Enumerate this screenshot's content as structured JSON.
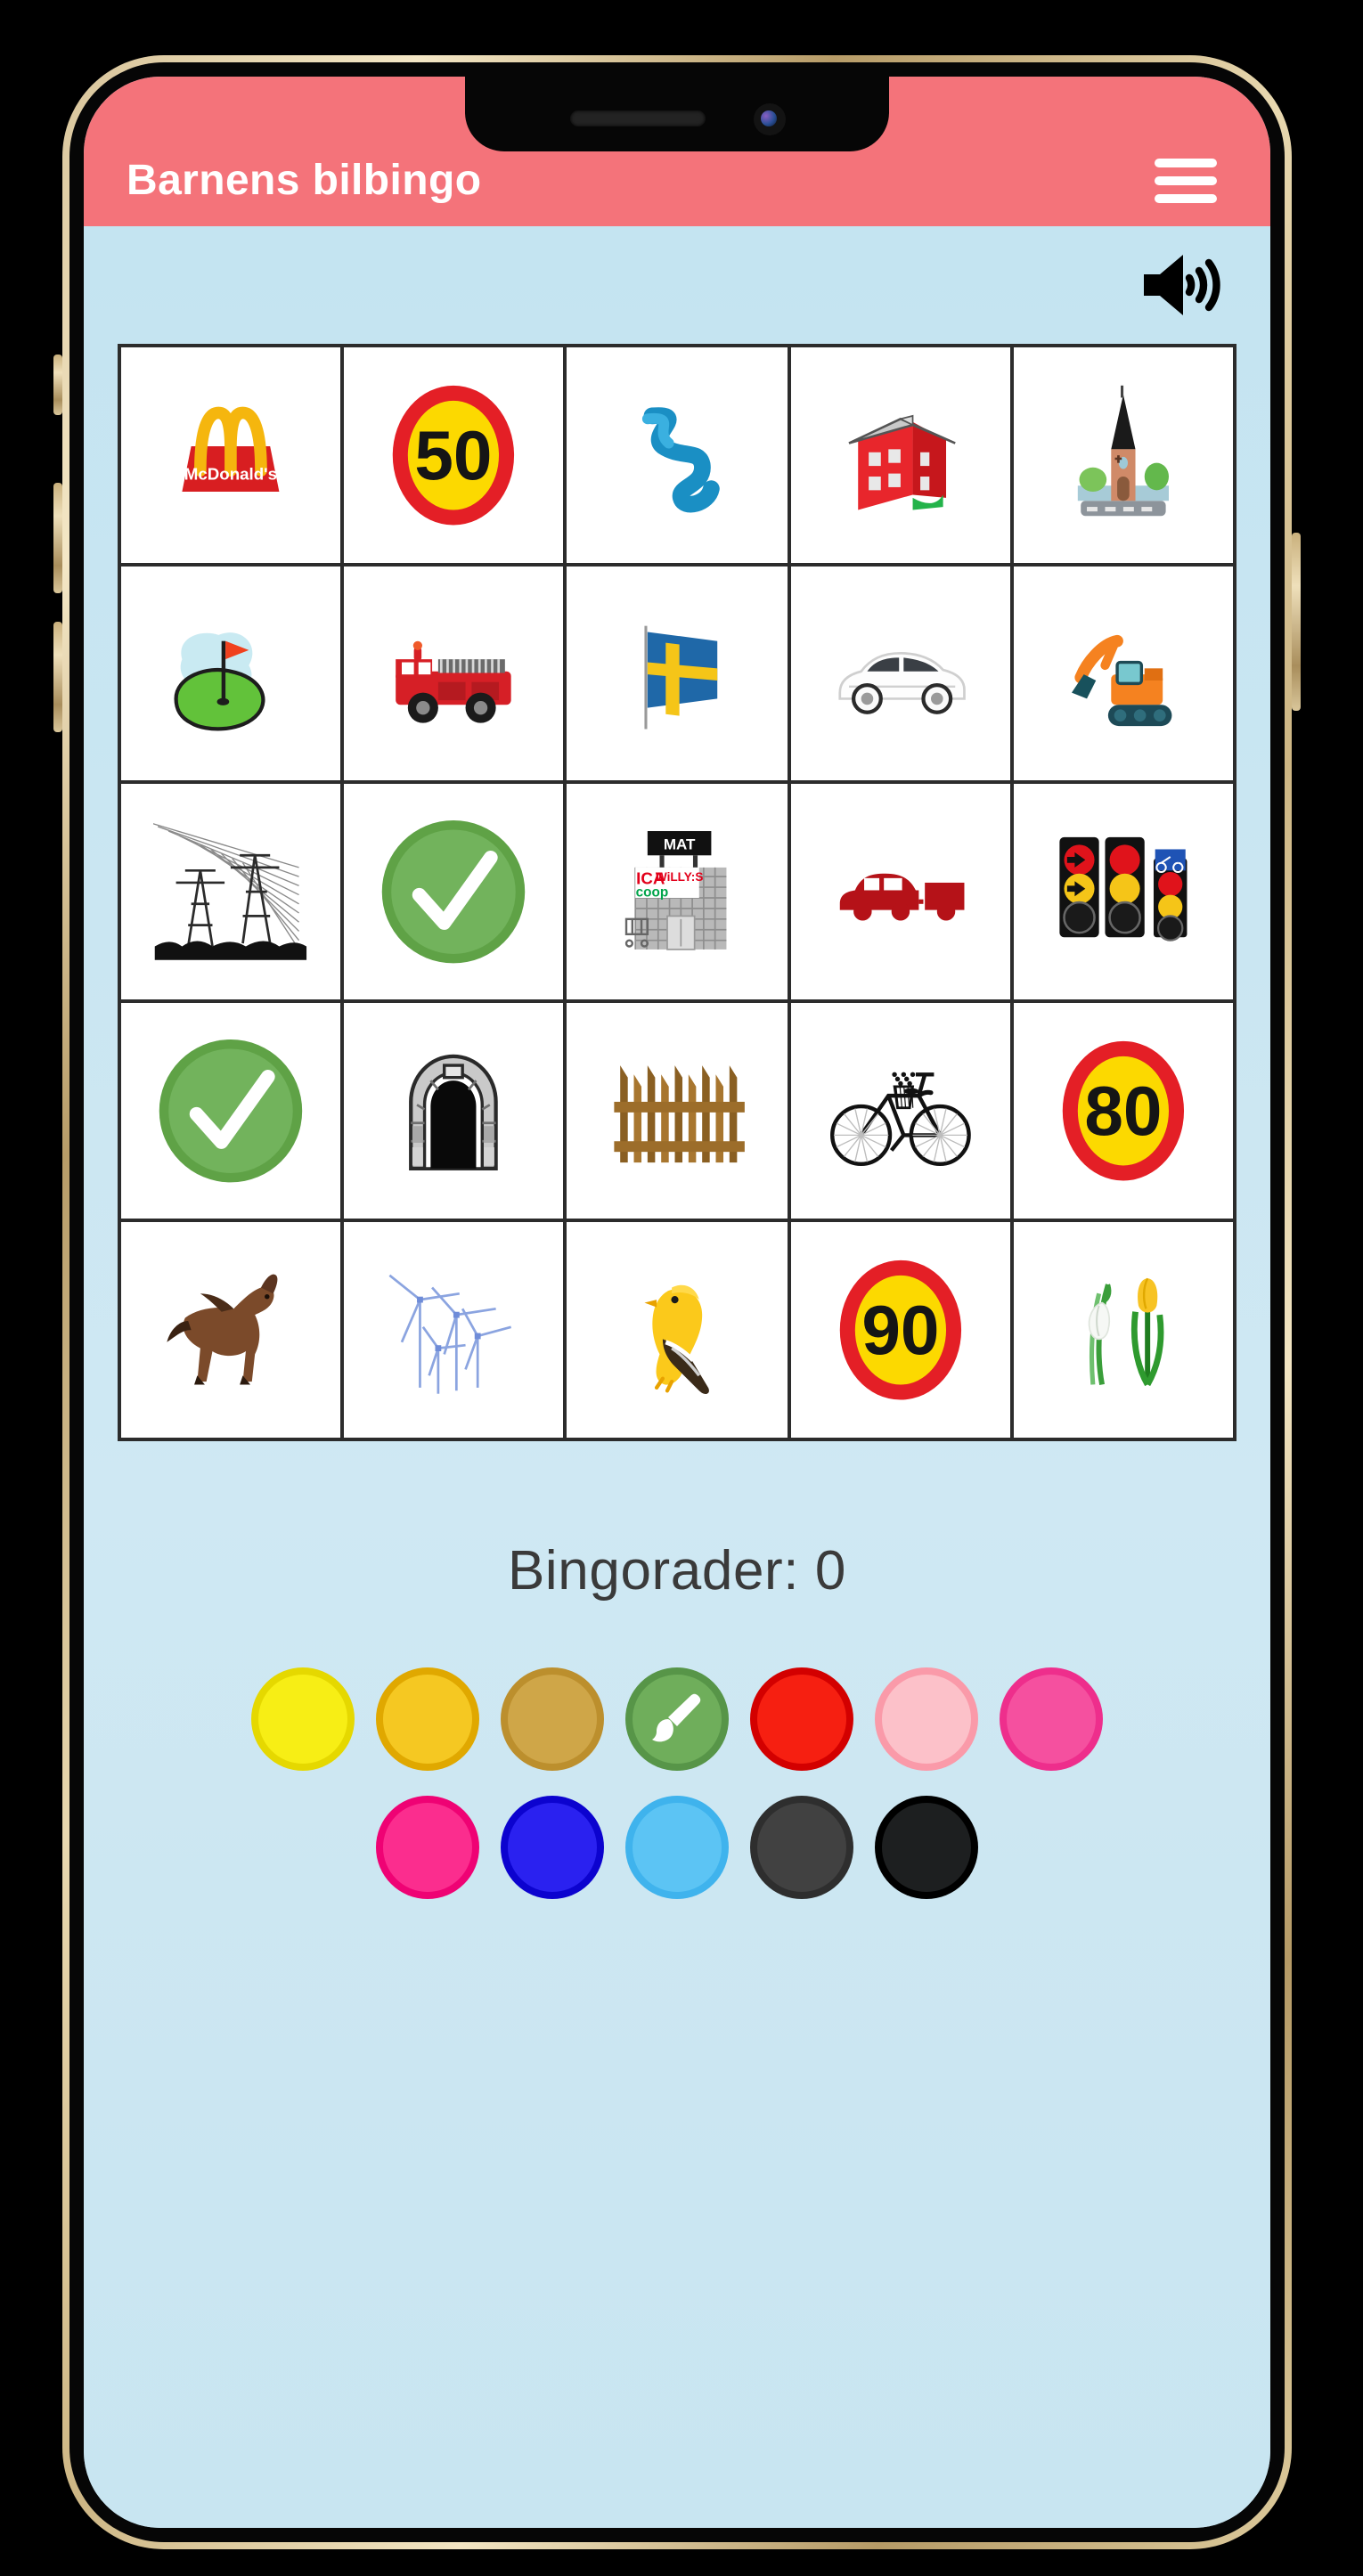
{
  "app": {
    "title": "Barnens bilbingo",
    "header_color": "#f4737a",
    "background_color": "#c6e5f2",
    "menu_icon": "hamburger-icon",
    "sound_icon": "speaker-icon"
  },
  "grid": {
    "rows": 5,
    "cols": 5,
    "cells": [
      {
        "id": "mcdonalds",
        "label": "McDonald's",
        "icon": "mcdonalds-icon",
        "marked": false
      },
      {
        "id": "sign50",
        "label": "50",
        "icon": "speed-sign-50-icon",
        "marked": false
      },
      {
        "id": "river",
        "label": "Å",
        "icon": "river-icon",
        "marked": false
      },
      {
        "id": "redhouse",
        "label": "Rött hus",
        "icon": "red-house-icon",
        "marked": false
      },
      {
        "id": "church",
        "label": "Kyrka",
        "icon": "church-icon",
        "marked": false
      },
      {
        "id": "golf",
        "label": "Golfbana",
        "icon": "golf-course-icon",
        "marked": false
      },
      {
        "id": "firetruck",
        "label": "Brandbil",
        "icon": "fire-truck-icon",
        "marked": false
      },
      {
        "id": "flag",
        "label": "Svensk flagga",
        "icon": "swedish-flag-icon",
        "marked": false
      },
      {
        "id": "whitecar",
        "label": "Vit bil",
        "icon": "white-car-icon",
        "marked": false
      },
      {
        "id": "excavator",
        "label": "Grävmaskin",
        "icon": "excavator-icon",
        "marked": false
      },
      {
        "id": "powerlines",
        "label": "Kraftledning",
        "icon": "power-lines-icon",
        "marked": false
      },
      {
        "id": "marked-a",
        "label": "Markerad",
        "icon": "checkmark-icon",
        "marked": true
      },
      {
        "id": "grocery",
        "label": "Mataffär",
        "icon": "grocery-store-icon",
        "marked": false
      },
      {
        "id": "cartrailer",
        "label": "Bil med släp",
        "icon": "car-trailer-icon",
        "marked": false
      },
      {
        "id": "trafficlight",
        "label": "Trafikljus",
        "icon": "traffic-light-icon",
        "marked": false
      },
      {
        "id": "marked-b",
        "label": "Markerad",
        "icon": "checkmark-icon",
        "marked": true
      },
      {
        "id": "tunnel",
        "label": "Tunnel",
        "icon": "tunnel-icon",
        "marked": false
      },
      {
        "id": "fence",
        "label": "Staket",
        "icon": "fence-icon",
        "marked": false
      },
      {
        "id": "bicycle",
        "label": "Cykel",
        "icon": "bicycle-icon",
        "marked": false
      },
      {
        "id": "sign80",
        "label": "80",
        "icon": "speed-sign-80-icon",
        "marked": false
      },
      {
        "id": "horse",
        "label": "Häst",
        "icon": "horse-icon",
        "marked": false
      },
      {
        "id": "windmills",
        "label": "Vindkraftverk",
        "icon": "wind-turbine-icon",
        "marked": false
      },
      {
        "id": "bird",
        "label": "Fågel",
        "icon": "yellow-bird-icon",
        "marked": false
      },
      {
        "id": "sign90",
        "label": "90",
        "icon": "speed-sign-90-icon",
        "marked": false
      },
      {
        "id": "flowers",
        "label": "Blommor",
        "icon": "flowers-icon",
        "marked": false
      }
    ],
    "sign_values": {
      "sign50": "50",
      "sign80": "80",
      "sign90": "90"
    },
    "store_signs": {
      "top": "MAT",
      "ica": "ICA",
      "willys": "WiLLY:S",
      "coop": "coop"
    },
    "mcdonalds_text": "McDonald's"
  },
  "status": {
    "bingo_label": "Bingorader:",
    "bingo_rows": "0",
    "bingo_text": "Bingorader: 0"
  },
  "palette": {
    "selected_index": 3,
    "brush_icon": "paintbrush-icon",
    "row1": [
      {
        "name": "yellow",
        "color": "#f7ee15",
        "ring": "#e5d800",
        "selected": false
      },
      {
        "name": "golden",
        "color": "#f5c822",
        "ring": "#e0a800",
        "selected": false
      },
      {
        "name": "dark-gold",
        "color": "#cfa648",
        "ring": "#bc8f2d",
        "selected": false
      },
      {
        "name": "green",
        "color": "#6fae5b",
        "ring": "#579548",
        "selected": true
      },
      {
        "name": "red",
        "color": "#f61f11",
        "ring": "#d30000",
        "selected": false
      },
      {
        "name": "light-pink",
        "color": "#fcc1c9",
        "ring": "#fa9aa9",
        "selected": false
      },
      {
        "name": "hot-pink",
        "color": "#f5509f",
        "ring": "#ee2e8c",
        "selected": false
      }
    ],
    "row2": [
      {
        "name": "magenta",
        "color": "#fb2d8e",
        "ring": "#ef0274",
        "selected": false
      },
      {
        "name": "blue",
        "color": "#2a21f0",
        "ring": "#0c03cf",
        "selected": false
      },
      {
        "name": "light-blue",
        "color": "#5cc4f4",
        "ring": "#3fb3ed",
        "selected": false
      },
      {
        "name": "dark-gray",
        "color": "#414141",
        "ring": "#2e2e2e",
        "selected": false
      },
      {
        "name": "black",
        "color": "#1d1f20",
        "ring": "#000000",
        "selected": false
      }
    ]
  }
}
